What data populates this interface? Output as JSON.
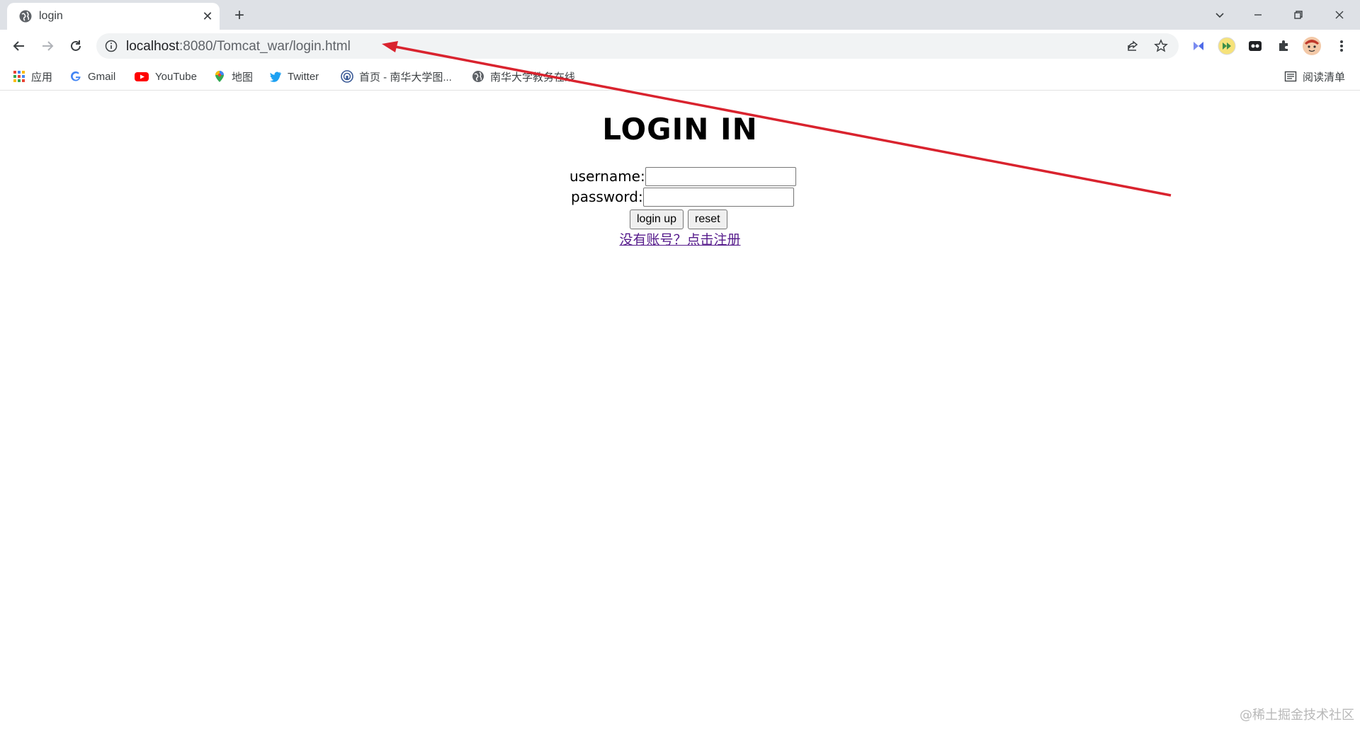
{
  "browser": {
    "tab": {
      "title": "login",
      "favicon": "globe-icon"
    },
    "address_bar": {
      "host": "localhost",
      "rest": ":8080/Tomcat_war/login.html"
    },
    "bookmarks": [
      {
        "label": "应用",
        "icon": "apps-grid-icon"
      },
      {
        "label": "Gmail",
        "icon": "google-icon"
      },
      {
        "label": "YouTube",
        "icon": "youtube-icon"
      },
      {
        "label": "地图",
        "icon": "maps-pin-icon"
      },
      {
        "label": "Twitter",
        "icon": "twitter-bird-icon"
      },
      {
        "label": "首页 - 南华大学图...",
        "icon": "library-icon"
      },
      {
        "label": "南华大学教务在线",
        "icon": "globe-icon"
      }
    ],
    "reading_list": {
      "label": "阅读清单",
      "icon": "reading-list-icon"
    }
  },
  "page": {
    "heading": "LOGIN IN",
    "username_label": "username:",
    "password_label": "password:",
    "login_button": "login up",
    "reset_button": "reset",
    "register_link": "没有账号？点击注册"
  },
  "watermark": "@稀土掘金技术社区",
  "colors": {
    "annotation_arrow": "#d9232e",
    "link_visited": "#551a8b",
    "tabstrip": "#dee1e6"
  }
}
